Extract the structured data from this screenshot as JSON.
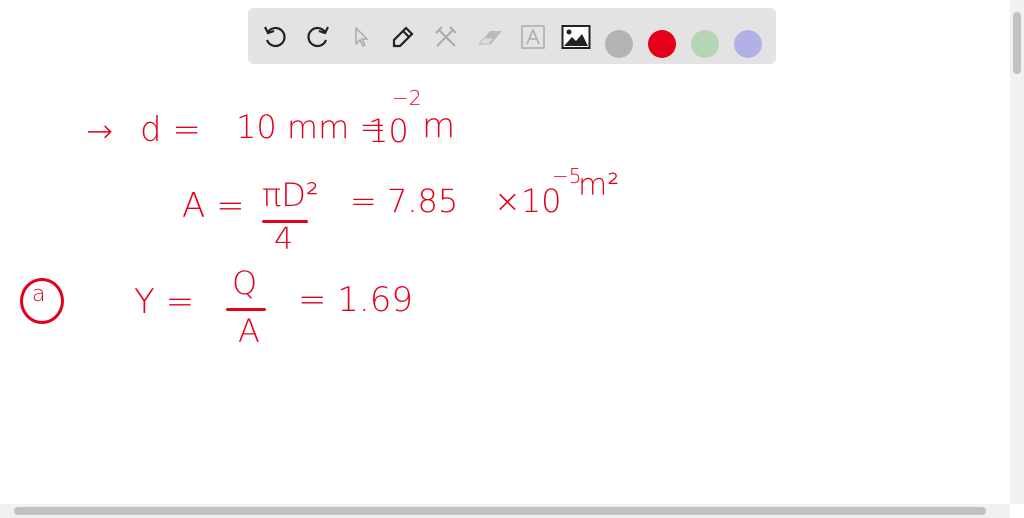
{
  "toolbar": {
    "tools": [
      "undo-icon",
      "redo-icon",
      "select-icon",
      "pen-icon",
      "tools-icon",
      "eraser-icon",
      "text-icon",
      "image-icon"
    ],
    "colors": [
      "#b3b3b3",
      "#e5001a",
      "#b5d5b5",
      "#b3b0e5"
    ],
    "selected_color": "#e5001a"
  },
  "canvas": {
    "line1": {
      "arrow": "→",
      "lhs": "d =",
      "mid": "10 mm =",
      "base": "10",
      "exp": "−2",
      "unit": "m"
    },
    "line2": {
      "lhs": "A =",
      "num": "πD²",
      "den": "4",
      "eq": "= 7.85",
      "times": "×10",
      "exp": "−5",
      "unit": "m²"
    },
    "line3": {
      "label": "a",
      "lhs": "Y =",
      "num": "Q",
      "den": "A",
      "rhs": "= 1.69"
    }
  }
}
